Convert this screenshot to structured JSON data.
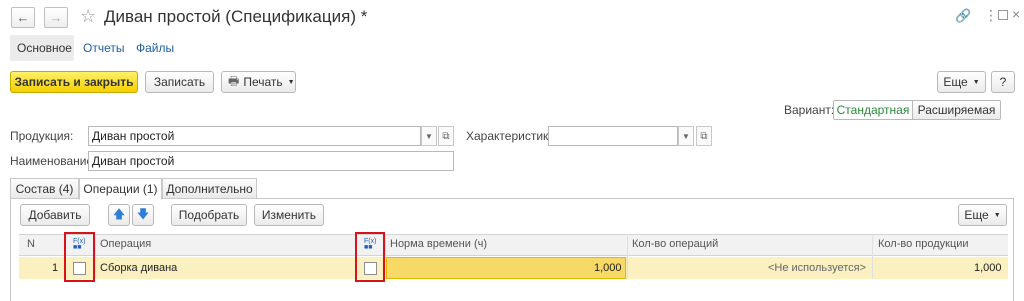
{
  "window": {
    "title": "Диван простой (Спецификация) *"
  },
  "nav_tabs": [
    "Основное",
    "Отчеты",
    "Файлы"
  ],
  "toolbar": {
    "save_close_label": "Записать и закрыть",
    "save_label": "Записать",
    "print_label": "Печать",
    "more_label": "Еще",
    "help_label": "?"
  },
  "variant": {
    "label": "Вариант:",
    "options": [
      "Стандартная",
      "Расширяемая"
    ],
    "selected": "Стандартная"
  },
  "form": {
    "product_label": "Продукция:",
    "product_value": "Диван простой",
    "characteristic_label": "Характеристика:",
    "characteristic_value": "",
    "name_label": "Наименование:",
    "name_value": "Диван простой"
  },
  "section_tabs": [
    "Состав (4)",
    "Операции (1)",
    "Дополнительно"
  ],
  "grid_toolbar": {
    "add_label": "Добавить",
    "pick_label": "Подобрать",
    "change_label": "Изменить",
    "more_label": "Еще"
  },
  "table": {
    "columns": [
      "N",
      "Операция",
      "Норма времени (ч)",
      "Кол-во операций",
      "Кол-во продукции"
    ],
    "rows": [
      {
        "n": "1",
        "operation": "Сборка дивана",
        "time_norm": "1,000",
        "op_count": "<Не используется>",
        "product_count": "1,000"
      }
    ]
  },
  "colors": {
    "accent_yellow": "#f4d000",
    "highlight_row": "#fbf0c0",
    "link_blue": "#1f5fa0",
    "variant_selected": "#2a8a3a",
    "annotation_red": "#d8121a"
  }
}
